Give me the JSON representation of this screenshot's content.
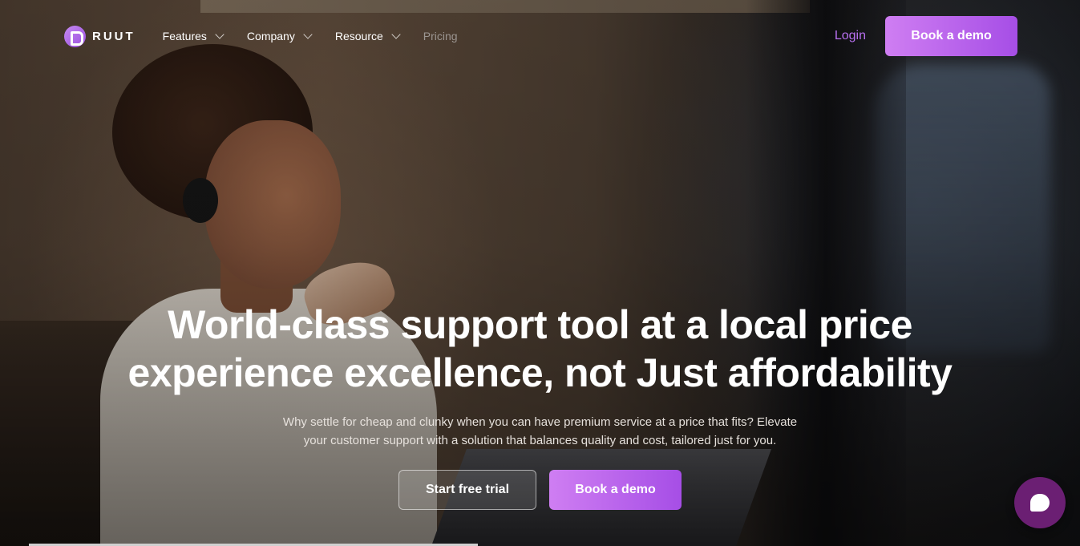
{
  "brand": {
    "name": "RUUT",
    "accent": "#b870f0",
    "button_gradient": [
      "#cf7ef2",
      "#a64ee6"
    ]
  },
  "nav": {
    "items": [
      {
        "label": "Features",
        "dropdown": true
      },
      {
        "label": "Company",
        "dropdown": true
      },
      {
        "label": "Resource",
        "dropdown": true
      },
      {
        "label": "Pricing",
        "dropdown": false
      }
    ],
    "login_label": "Login",
    "demo_label": "Book a demo"
  },
  "hero": {
    "title_line1": "World-class support tool at a local price",
    "title_line2": "experience excellence, not Just affordability",
    "subtitle_line1": "Why settle for cheap and clunky when you can have premium service at a price that fits? Elevate",
    "subtitle_line2": "your customer support with a solution that balances quality and cost, tailored just for you.",
    "trial_label": "Start free trial",
    "demo_label": "Book a demo"
  },
  "chat_widget": {
    "color": "#6b1f73",
    "icon": "chat-bubble-icon"
  }
}
